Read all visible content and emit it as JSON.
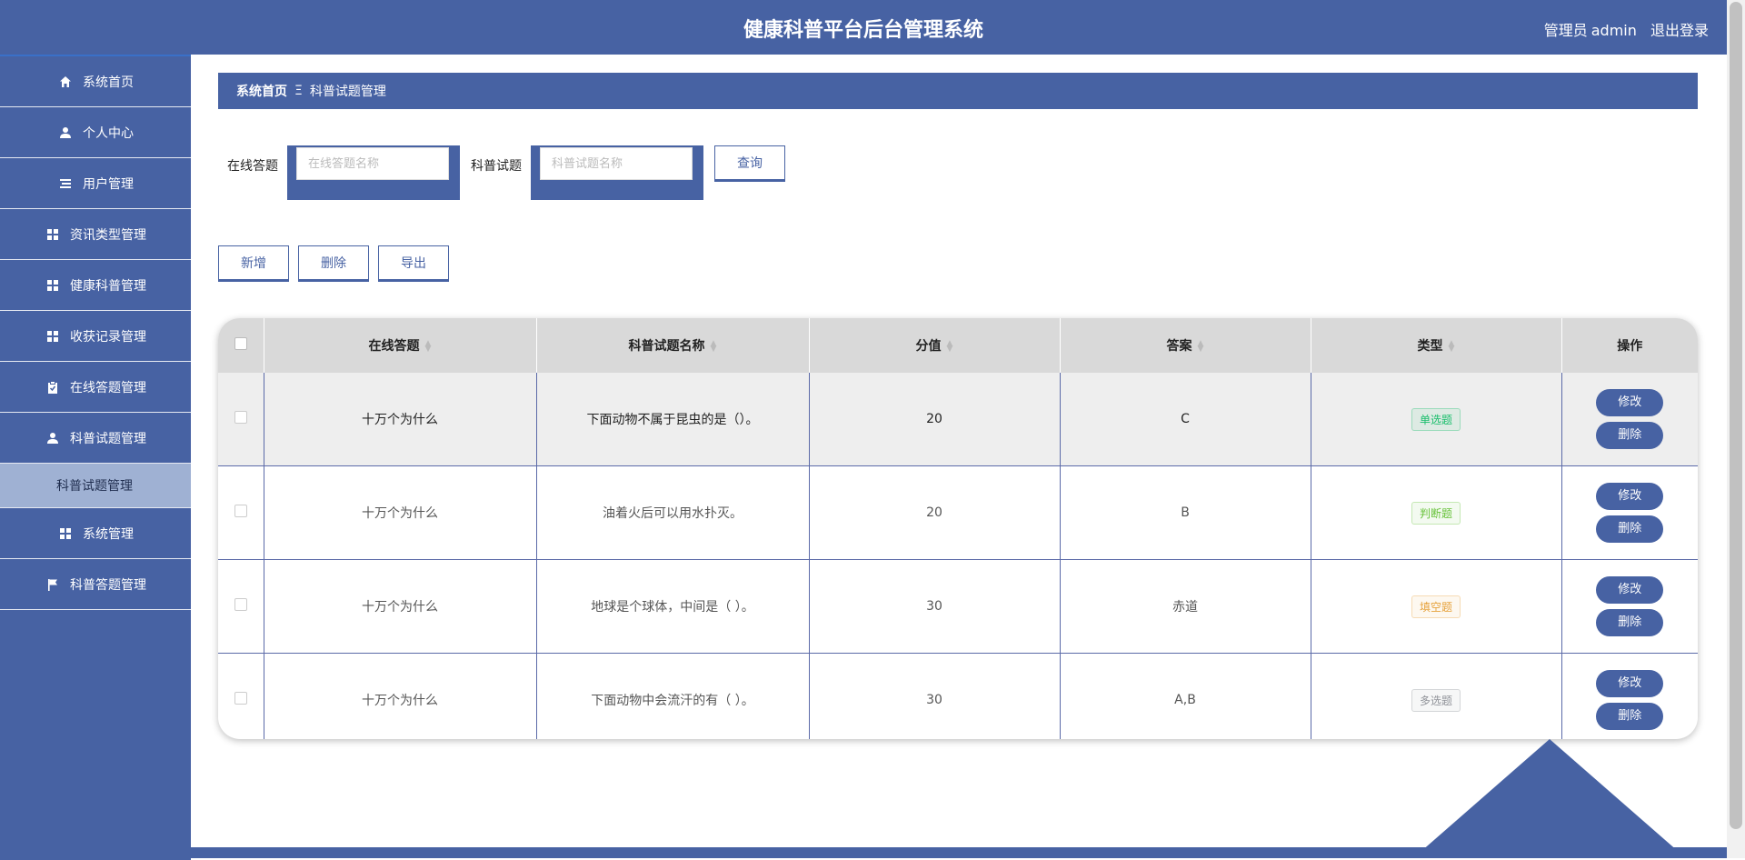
{
  "header": {
    "title": "健康科普平台后台管理系统",
    "role": "管理员",
    "username": "admin",
    "logout": "退出登录"
  },
  "sidebar": {
    "items": [
      {
        "label": "系统首页",
        "icon": "home-icon"
      },
      {
        "label": "个人中心",
        "icon": "user-icon"
      },
      {
        "label": "用户管理",
        "icon": "list-icon"
      },
      {
        "label": "资讯类型管理",
        "icon": "grid-icon"
      },
      {
        "label": "健康科普管理",
        "icon": "grid-icon"
      },
      {
        "label": "收获记录管理",
        "icon": "grid-icon"
      },
      {
        "label": "在线答题管理",
        "icon": "clipboard-icon"
      },
      {
        "label": "科普试题管理",
        "icon": "user-icon"
      },
      {
        "label": "科普试题管理",
        "active": true
      },
      {
        "label": "系统管理",
        "icon": "grid-icon"
      },
      {
        "label": "科普答题管理",
        "icon": "flag-icon"
      }
    ]
  },
  "breadcrumb": {
    "home": "系统首页",
    "separator": "Ξ",
    "current": "科普试题管理"
  },
  "search": {
    "field1_label": "在线答题",
    "field1_placeholder": "在线答题名称",
    "field2_label": "科普试题",
    "field2_placeholder": "科普试题名称",
    "query_button": "查询"
  },
  "actions": {
    "add": "新增",
    "delete": "删除",
    "export": "导出"
  },
  "table": {
    "headers": [
      "在线答题",
      "科普试题名称",
      "分值",
      "答案",
      "类型",
      "操作"
    ],
    "rows": [
      {
        "quiz": "十万个为什么",
        "question": "下面动物不属于昆虫的是（）。",
        "score": "20",
        "answer": "C",
        "type": "单选题",
        "type_color": "#19be6b"
      },
      {
        "quiz": "十万个为什么",
        "question": "油着火后可以用水扑灭。",
        "score": "20",
        "answer": "B",
        "type": "判断题",
        "type_color": "#67c23a"
      },
      {
        "quiz": "十万个为什么",
        "question": "地球是个球体，中间是（ ）。",
        "score": "30",
        "answer": "赤道",
        "type": "填空题",
        "type_color": "#e6a23c"
      },
      {
        "quiz": "十万个为什么",
        "question": "下面动物中会流汗的有（ ）。",
        "score": "30",
        "answer": "A,B",
        "type": "多选题",
        "type_color": "#909399"
      }
    ],
    "edit_label": "修改",
    "delete_label": "删除"
  }
}
